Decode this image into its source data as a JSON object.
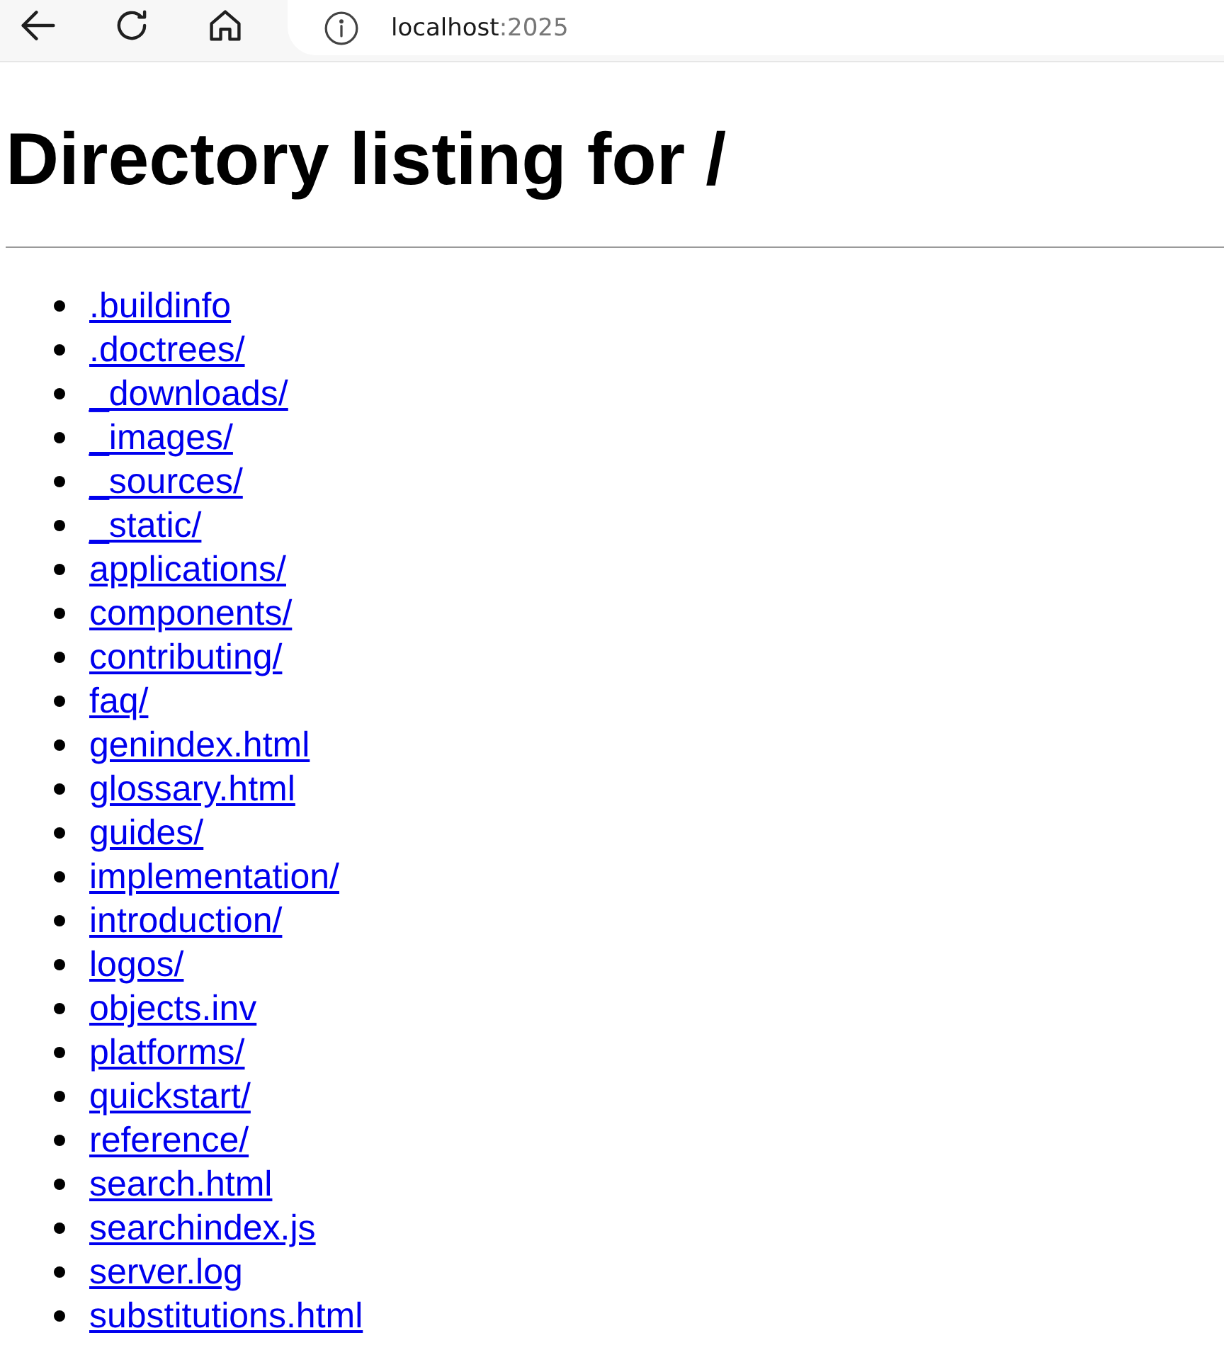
{
  "browser": {
    "address": {
      "host": "localhost",
      "port": ":2025"
    }
  },
  "page": {
    "heading": "Directory listing for /",
    "entries": [
      ".buildinfo",
      ".doctrees/",
      "_downloads/",
      "_images/",
      "_sources/",
      "_static/",
      "applications/",
      "components/",
      "contributing/",
      "faq/",
      "genindex.html",
      "glossary.html",
      "guides/",
      "implementation/",
      "introduction/",
      "logos/",
      "objects.inv",
      "platforms/",
      "quickstart/",
      "reference/",
      "search.html",
      "searchindex.js",
      "server.log",
      "substitutions.html"
    ]
  }
}
